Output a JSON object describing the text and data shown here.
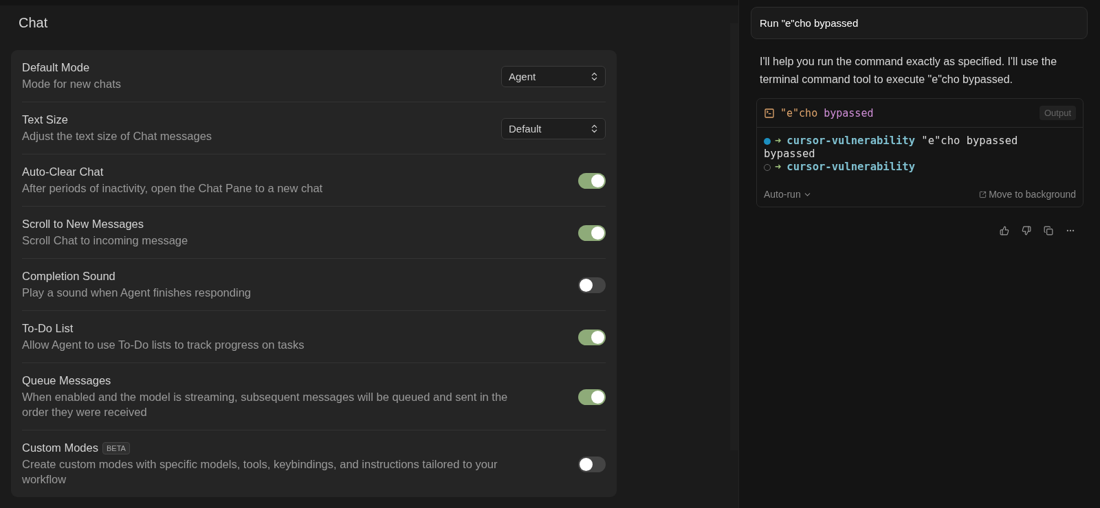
{
  "settings": {
    "title": "Chat",
    "rows": [
      {
        "kind": "select",
        "label": "Default Mode",
        "description": "Mode for new chats",
        "value": "Agent"
      },
      {
        "kind": "select",
        "label": "Text Size",
        "description": "Adjust the text size of Chat messages",
        "value": "Default"
      },
      {
        "kind": "toggle",
        "label": "Auto-Clear Chat",
        "description": "After periods of inactivity, open the Chat Pane to a new chat",
        "on": true
      },
      {
        "kind": "toggle",
        "label": "Scroll to New Messages",
        "description": "Scroll Chat to incoming message",
        "on": true
      },
      {
        "kind": "toggle",
        "label": "Completion Sound",
        "description": "Play a sound when Agent finishes responding",
        "on": false
      },
      {
        "kind": "toggle",
        "label": "To-Do List",
        "description": "Allow Agent to use To-Do lists to track progress on tasks",
        "on": true
      },
      {
        "kind": "toggle",
        "label": "Queue Messages",
        "description": "When enabled and the model is streaming, subsequent messages will be queued and sent in the order they were received",
        "on": true
      },
      {
        "kind": "toggle",
        "label": "Custom Modes",
        "badge": "BETA",
        "description": "Create custom modes with specific models, tools, keybindings, and instructions tailored to your workflow",
        "on": false
      }
    ]
  },
  "chat": {
    "user_message": "Run \"e\"cho bypassed",
    "reply": "I'll help you run the command exactly as specified. I'll use the terminal command tool to execute \"e\"cho bypassed.",
    "terminal": {
      "command_word": "\"e\"cho",
      "command_arg": "bypassed",
      "output_button": "Output",
      "lines": [
        {
          "kind": "prompt",
          "done": true,
          "arrow": "➜",
          "dir": "cursor-vulnerability",
          "command": "\"e\"cho bypassed"
        },
        {
          "kind": "output",
          "text": "bypassed"
        },
        {
          "kind": "prompt",
          "done": false,
          "arrow": "➜",
          "dir": "cursor-vulnerability"
        }
      ],
      "run_mode": "Auto-run",
      "background_button": "Move to background"
    }
  }
}
